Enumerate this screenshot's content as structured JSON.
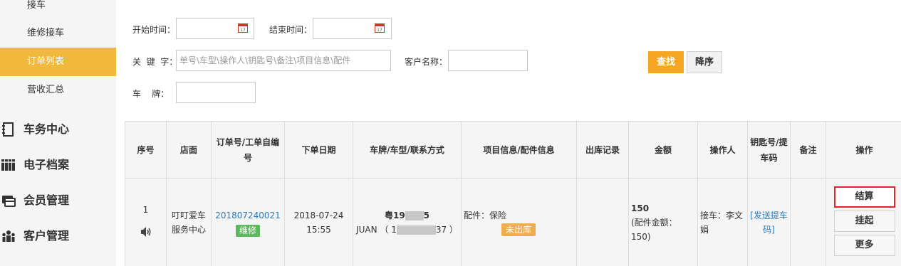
{
  "sidebar": {
    "sub_items": [
      {
        "label": "接车",
        "active": false
      },
      {
        "label": "维修接车",
        "active": false
      },
      {
        "label": "订单列表",
        "active": true
      },
      {
        "label": "营收汇总",
        "active": false
      }
    ],
    "main_items": [
      {
        "label": "车务中心",
        "icon": "document-icon"
      },
      {
        "label": "电子档案",
        "icon": "archive-icon"
      },
      {
        "label": "会员管理",
        "icon": "member-card-icon"
      },
      {
        "label": "客户管理",
        "icon": "customers-icon"
      }
    ]
  },
  "filters": {
    "start_label": "开始时间：",
    "start_value": "",
    "end_label": "结束时间：",
    "end_value": "",
    "keyword_label": "关  键  字：",
    "keyword_placeholder": "单号\\车型\\操作人\\钥匙号\\备注\\项目信息\\配件",
    "customer_label": "客户名称：",
    "customer_value": "",
    "plate_label": "车    牌：",
    "plate_value": "",
    "search_button": "查找",
    "sort_button": "降序"
  },
  "table": {
    "headers": {
      "index": "序号",
      "store": "店面",
      "order_no": "订单号/工单自编号",
      "order_date": "下单日期",
      "vehicle": "车牌/车型/联系方式",
      "project": "项目信息/配件信息",
      "outbound": "出库记录",
      "amount": "金额",
      "operator": "操作人",
      "key": "钥匙号/提车码",
      "remark": "备注",
      "actions": "操作"
    },
    "row": {
      "index": "1",
      "store": "叮叮爱车服务中心",
      "order_no": "201807240021",
      "order_tag": "维修",
      "date": "2018-07-24",
      "time": "15:55",
      "plate_prefix": "粤19",
      "plate_suffix": "5",
      "contact_name": "JUAN",
      "contact_open": "（ 1",
      "contact_close": "37 ）",
      "project_text": "配件：保险",
      "outbound_status": "未出库",
      "amount": "150",
      "amount_detail": "(配件金额：150)",
      "operator": "接车：李文娟",
      "send_code": "[发送提车码]",
      "remark": "",
      "btn_settle": "结算",
      "btn_hold": "挂起",
      "btn_more": "更多"
    }
  },
  "colors": {
    "accent": "#f0b93b",
    "search_button": "#f5a623",
    "tag_green": "#5cb85c",
    "tag_orange": "#f0ad4e",
    "link": "#2a7ab8",
    "highlight_border": "#e0262a"
  }
}
